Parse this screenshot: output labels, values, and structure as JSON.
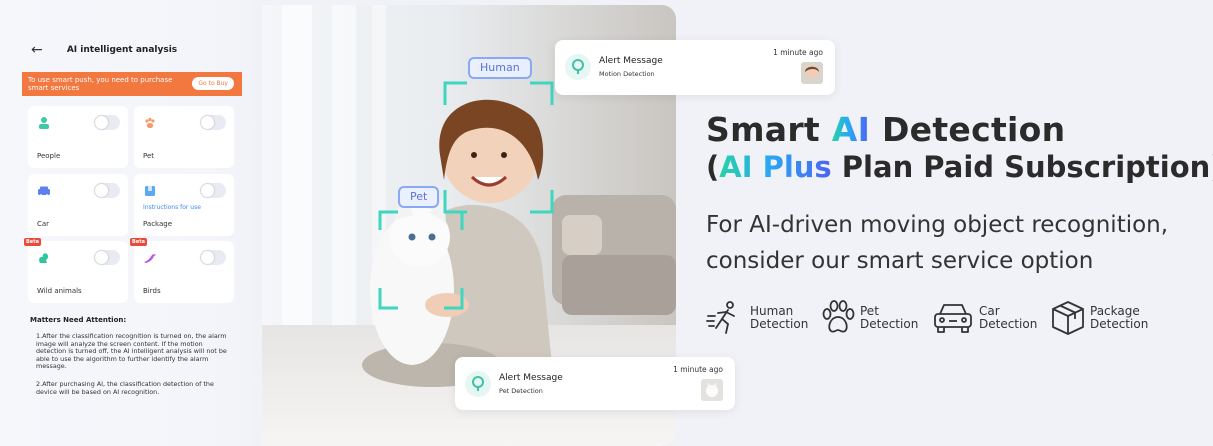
{
  "screen": {
    "title": "AI intelligent analysis",
    "banner_text": "To use smart push, you need to purchase smart services",
    "buy_label": "Go to Buy"
  },
  "cards": [
    {
      "label": "People",
      "icon": "person-icon"
    },
    {
      "label": "Pet",
      "icon": "paw-icon"
    },
    {
      "label": "Car",
      "icon": "car-icon"
    },
    {
      "label": "Package",
      "icon": "package-icon",
      "link": "Instructions for use"
    },
    {
      "label": "Wild animals",
      "icon": "squirrel-icon",
      "badge": "Beta"
    },
    {
      "label": "Birds",
      "icon": "bird-icon",
      "badge": "Beta"
    }
  ],
  "notes": {
    "title": "Matters Need Attention:",
    "items": [
      "1.After the classification recognition is turned on, the alarm image will analyze the screen content. If the motion detection is turned off, the AI intelligent analysis will not be able to use the algorithm to further identify the alarm message.",
      "2.After purchasing AI, the classification detection of the device will be based on AI recognition."
    ]
  },
  "photo_tags": {
    "human": "Human",
    "pet": "Pet"
  },
  "alerts": [
    {
      "title": "Alert Message",
      "subtitle": "Motion Detection",
      "time": "1 minute ago"
    },
    {
      "title": "Alert Message",
      "subtitle": "Pet Detection",
      "time": "1 minute ago"
    }
  ],
  "headline": {
    "pre": "Smart ",
    "accent": "AI",
    "post": " Detection"
  },
  "subhead": {
    "pre": "(",
    "accent": "AI Plus",
    "post": " Plan Paid Subscription)"
  },
  "description": "For AI-driven moving object recognition, consider our smart service option",
  "features": [
    {
      "line1": "Human",
      "line2": "Detection",
      "icon": "running-person-icon"
    },
    {
      "line1": "Pet",
      "line2": "Detection",
      "icon": "paw-icon"
    },
    {
      "line1": "Car",
      "line2": "Detection",
      "icon": "car-icon"
    },
    {
      "line1": "Package",
      "line2": "Detection",
      "icon": "package-box-icon"
    }
  ],
  "colors": {
    "banner": "#f37840",
    "accent_start": "#27d3a6",
    "accent_end": "#4c62f2",
    "tag_border": "#8aa9f5",
    "detect_box": "#3fd6c0",
    "background": "#f1f2f8"
  }
}
